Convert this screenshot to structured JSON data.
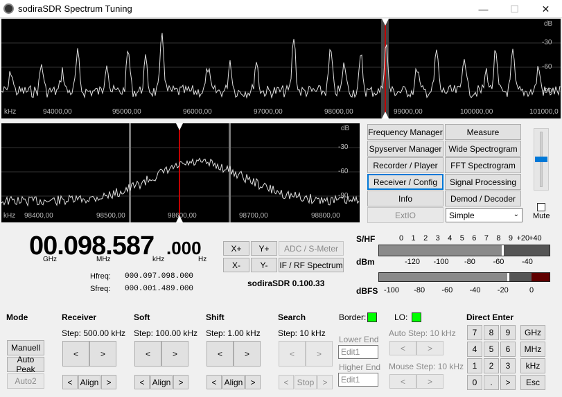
{
  "window": {
    "title": "sodiraSDR Spectrum Tuning",
    "minimize": "—",
    "maximize": "☐",
    "close": "✕"
  },
  "wide_spectrum": {
    "unit_left": "kHz",
    "unit_right": "dB",
    "db_ticks": [
      "-30",
      "-60",
      "-90"
    ],
    "freq_ticks": [
      "94000,00",
      "95000,00",
      "96000,00",
      "97000,00",
      "98000,00",
      "99000,00",
      "100000,00",
      "101000,0"
    ]
  },
  "narrow_spectrum": {
    "unit_left": "kHz",
    "unit_right": "dB",
    "db_ticks": [
      "-30",
      "-60",
      "-90"
    ],
    "freq_ticks": [
      "98400,00",
      "98500,00",
      "98600,00",
      "98700,00",
      "98800,00"
    ]
  },
  "tools": {
    "freq_manager": "Frequency Manager",
    "measure": "Measure",
    "spyserver": "Spyserver Manager",
    "wide_spectrogram": "Wide Spectrogram",
    "recorder": "Recorder / Player",
    "fft_spectrogram": "FFT Spectrogram",
    "receiver_config": "Receiver / Config",
    "signal_processing": "Signal Processing",
    "info": "Info",
    "demod": "Demod / Decoder",
    "extio": "ExtIO",
    "mode_select": "Simple",
    "mute": "Mute"
  },
  "frequency": {
    "big": "00.098.587",
    "small": ".000",
    "ghz": "GHz",
    "mhz": "MHz",
    "khz": "kHz",
    "hz": "Hz",
    "hfreq_label": "Hfreq:",
    "hfreq": "000.097.098.000",
    "sfreq_label": "Sfreq:",
    "sfreq": "000.001.489.000"
  },
  "zoom": {
    "xplus": "X+",
    "yplus": "Y+",
    "xminus": "X-",
    "yminus": "Y-",
    "adc": "ADC / S-Meter",
    "if_rf": "IF / RF Spectrum"
  },
  "version": "sodiraSDR 0.100.33",
  "meters": {
    "shf": "S/HF",
    "dbm": "dBm",
    "dbfs": "dBFS",
    "s_ticks": [
      "0",
      "1",
      "2",
      "3",
      "4",
      "5",
      "6",
      "7",
      "8",
      "9",
      "+20",
      "+40"
    ],
    "dbm_ticks": [
      "-120",
      "-100",
      "-80",
      "-60",
      "-40"
    ],
    "dbfs_ticks": [
      "-100",
      "-80",
      "-60",
      "-40",
      "-20",
      "0"
    ],
    "s_level": 0.72,
    "dbfs_level": 0.75
  },
  "mode": {
    "title": "Mode",
    "manuell": "Manuell",
    "auto_peak": "Auto Peak",
    "auto2": "Auto2"
  },
  "receiver": {
    "title": "Receiver",
    "step": "Step: 500.00 kHz",
    "left": "<",
    "right": ">",
    "align": "Align"
  },
  "soft": {
    "title": "Soft",
    "step": "Step: 100.00 kHz",
    "left": "<",
    "right": ">",
    "align": "Align"
  },
  "shift": {
    "title": "Shift",
    "step": "Step: 1.00 kHz",
    "left": "<",
    "right": ">",
    "align": "Align"
  },
  "search": {
    "title": "Search",
    "step": "Step: 10 kHz",
    "left": "<",
    "right": ">",
    "stop": "Stop"
  },
  "border": {
    "title": "Border:",
    "lower": "Lower End",
    "lower_val": "Edit1",
    "higher": "Higher End",
    "higher_val": "Edit1"
  },
  "lo": {
    "title": "LO:",
    "auto_step": "Auto Step: 10 kHz",
    "mouse_step": "Mouse Step: 10 kHz",
    "left": "<",
    "right": ">"
  },
  "direct": {
    "title": "Direct Enter",
    "keys": [
      "7",
      "8",
      "9",
      "GHz",
      "4",
      "5",
      "6",
      "MHz",
      "1",
      "2",
      "3",
      "kHz",
      "0",
      ".",
      ">",
      "Esc"
    ]
  }
}
